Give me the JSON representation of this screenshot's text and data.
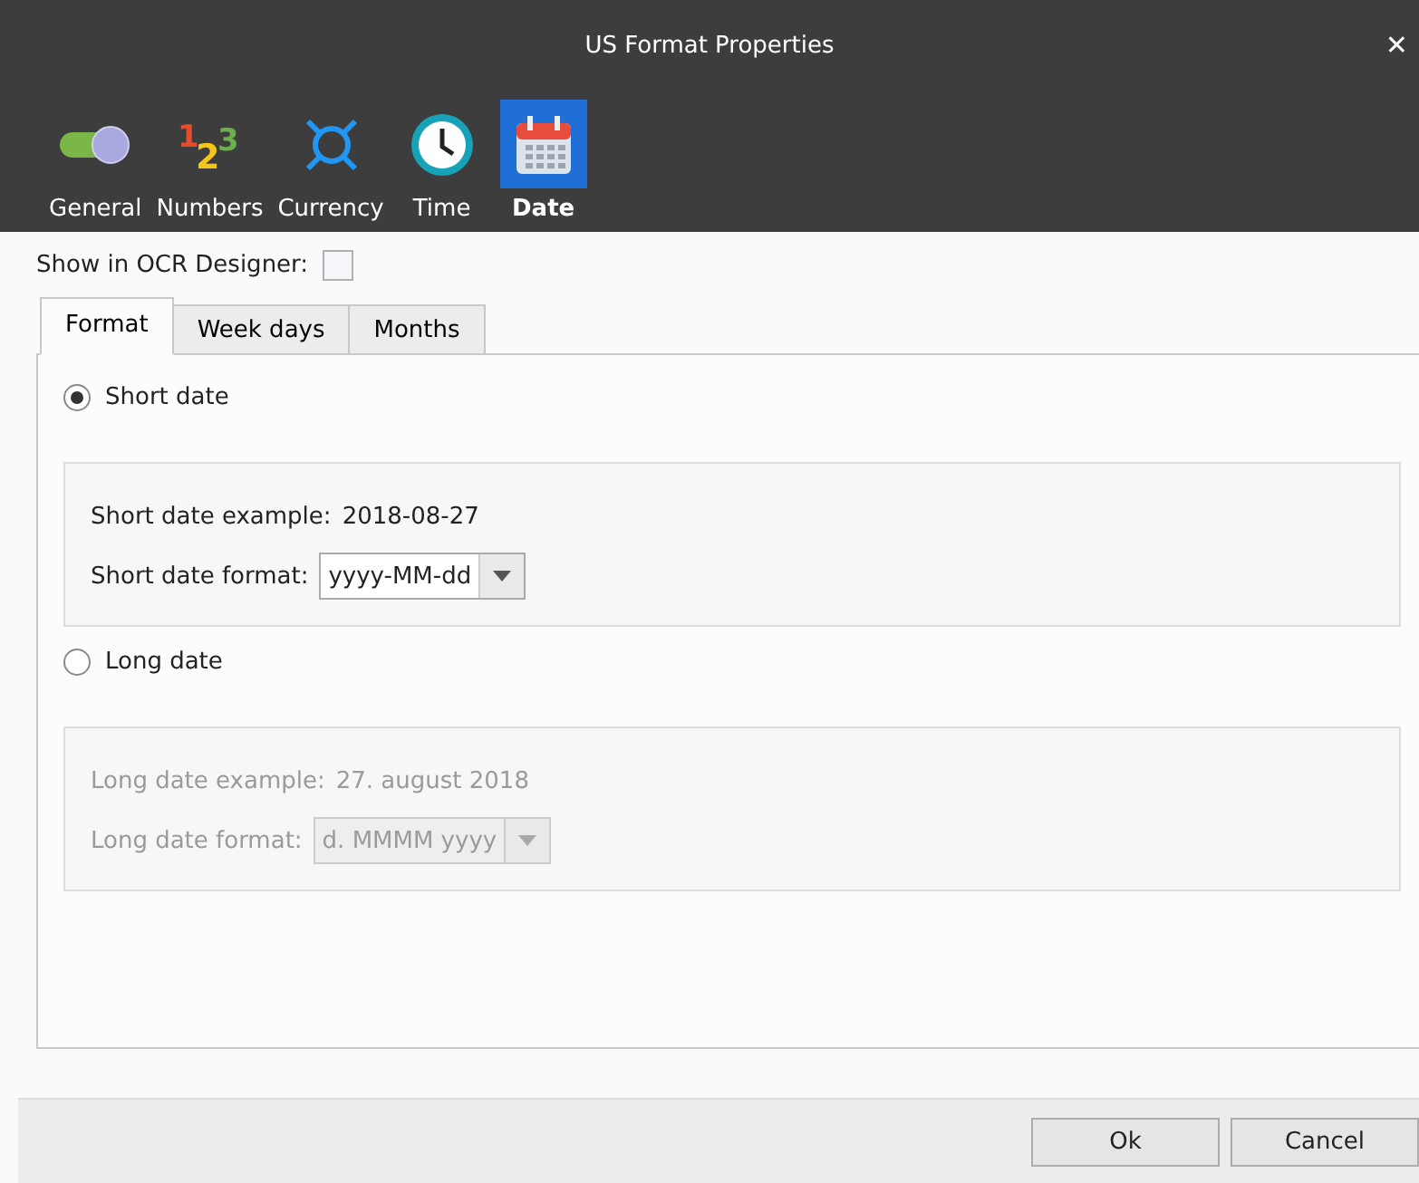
{
  "window": {
    "title": "US Format Properties",
    "close": "✕"
  },
  "categories": [
    {
      "label": "General",
      "kind": "toggle",
      "selected": false
    },
    {
      "label": "Numbers",
      "kind": "numbers",
      "icon_digits": [
        "1",
        "2",
        "3"
      ],
      "selected": false
    },
    {
      "label": "Currency",
      "kind": "currency",
      "selected": false
    },
    {
      "label": "Time",
      "kind": "clock",
      "selected": false
    },
    {
      "label": "Date",
      "kind": "calendar",
      "selected": true
    }
  ],
  "show_in_ocr": {
    "label": "Show in OCR Designer:",
    "checked": false
  },
  "tabs": [
    {
      "label": "Format",
      "selected": true
    },
    {
      "label": "Week days",
      "selected": false
    },
    {
      "label": "Months",
      "selected": false
    }
  ],
  "options": [
    {
      "label": "Short date",
      "selected": true,
      "example_label": "Short date example:",
      "example": "2018-08-27",
      "format_label": "Short date format:",
      "format": "yyyy-MM-dd"
    },
    {
      "label": "Long date",
      "selected": false,
      "example_label": "Long date example:",
      "example": "27. august 2018",
      "format_label": "Long date format:",
      "format": "d. MMMM yyyy"
    }
  ],
  "buttons": [
    "Ok",
    "Cancel"
  ]
}
